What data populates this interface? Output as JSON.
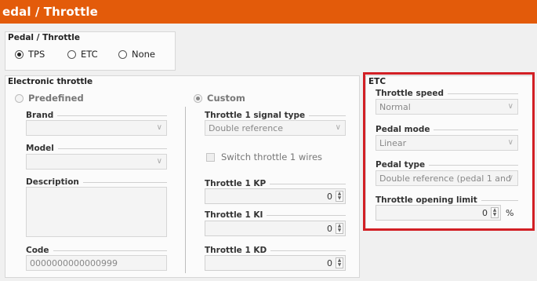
{
  "header": {
    "title": "edal / Throttle"
  },
  "pedal_throttle": {
    "title": "Pedal / Throttle",
    "options": [
      {
        "label": "TPS",
        "checked": true
      },
      {
        "label": "ETC",
        "checked": false
      },
      {
        "label": "None",
        "checked": false
      }
    ]
  },
  "electronic_throttle": {
    "title": "Electronic throttle",
    "predefined_label": "Predefined",
    "custom_label": "Custom",
    "brand": {
      "label": "Brand",
      "value": ""
    },
    "model": {
      "label": "Model",
      "value": ""
    },
    "description": {
      "label": "Description"
    },
    "code": {
      "label": "Code",
      "value": "0000000000000999"
    },
    "signal_type": {
      "label": "Throttle 1 signal type",
      "value": "Double reference"
    },
    "switch_wires": {
      "label": "Switch throttle 1 wires",
      "checked": false
    },
    "kp": {
      "label": "Throttle 1 KP",
      "value": "0"
    },
    "ki": {
      "label": "Throttle 1 KI",
      "value": "0"
    },
    "kd": {
      "label": "Throttle 1 KD",
      "value": "0"
    }
  },
  "etc": {
    "title": "ETC",
    "highlight_color": "#d21f24",
    "throttle_speed": {
      "label": "Throttle speed",
      "value": "Normal"
    },
    "pedal_mode": {
      "label": "Pedal mode",
      "value": "Linear"
    },
    "pedal_type": {
      "label": "Pedal type",
      "value": "Double reference (pedal 1 and"
    },
    "opening_limit": {
      "label": "Throttle opening limit",
      "value": "0",
      "unit": "%"
    }
  },
  "colors": {
    "title_bar": "#e35b0a"
  }
}
